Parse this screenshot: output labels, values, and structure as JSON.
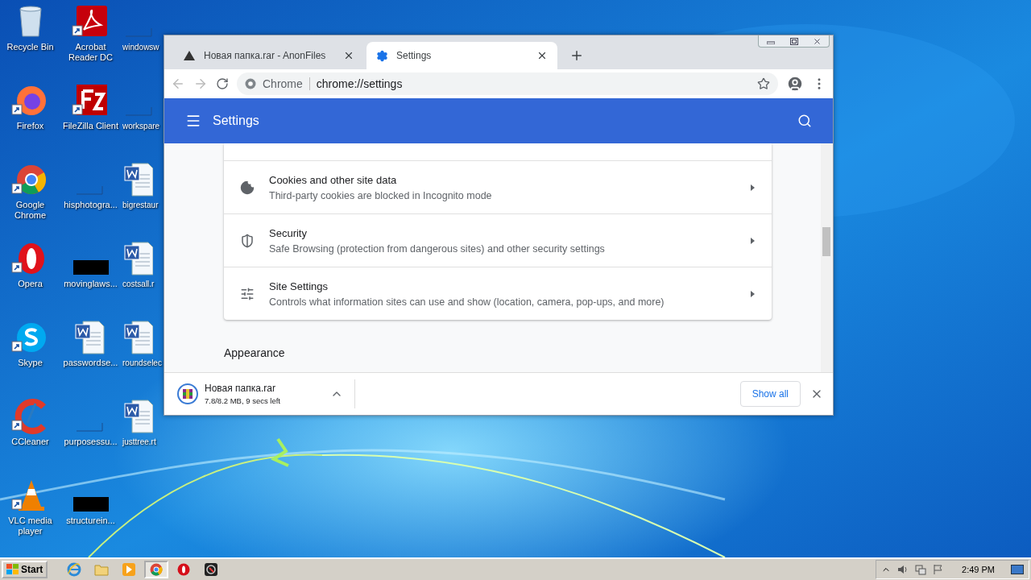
{
  "desktop": {
    "icons": [
      {
        "label": "Recycle Bin",
        "kind": "recycle"
      },
      {
        "label": "Firefox",
        "kind": "firefox"
      },
      {
        "label": "Google Chrome",
        "kind": "chrome"
      },
      {
        "label": "Opera",
        "kind": "opera"
      },
      {
        "label": "Skype",
        "kind": "skype"
      },
      {
        "label": "CCleaner",
        "kind": "ccleaner"
      },
      {
        "label": "VLC media player",
        "kind": "vlc"
      },
      {
        "label": "Acrobat Reader DC",
        "kind": "pdf"
      },
      {
        "label": "FileZilla Client",
        "kind": "filezilla"
      },
      {
        "label": "hisphotogra...",
        "kind": "blank"
      },
      {
        "label": "movinglaws...",
        "kind": "redacted"
      },
      {
        "label": "passwordse...",
        "kind": "word"
      },
      {
        "label": "purposessu...",
        "kind": "blank"
      },
      {
        "label": "structurein...",
        "kind": "redacted"
      },
      {
        "label": "windowsw",
        "kind": "blank"
      },
      {
        "label": "workspare",
        "kind": "blank"
      },
      {
        "label": "bigrestaur",
        "kind": "word"
      },
      {
        "label": "costsall.r",
        "kind": "word"
      },
      {
        "label": "roundselec",
        "kind": "word"
      },
      {
        "label": "justtree.rt",
        "kind": "word"
      }
    ]
  },
  "browser": {
    "tabs": [
      {
        "title": "Новая папка.rar - AnonFiles",
        "selected": false,
        "kind": "site"
      },
      {
        "title": "Settings",
        "selected": true,
        "kind": "settings"
      }
    ],
    "address": {
      "label": "Chrome",
      "url": "chrome://settings"
    },
    "header": {
      "title": "Settings"
    },
    "rows": [
      {
        "title": "Cookies and other site data",
        "description": "Third-party cookies are blocked in Incognito mode",
        "kind": "cookies"
      },
      {
        "title": "Security",
        "description": "Safe Browsing (protection from dangerous sites) and other security settings",
        "kind": "security"
      },
      {
        "title": "Site Settings",
        "description": "Controls what information sites can use and show (location, camera, pop-ups, and more)",
        "kind": "sliders"
      }
    ],
    "section_heading": "Appearance",
    "download": {
      "filename": "Новая папка.rar",
      "status": "7.8/8.2 MB, 9 secs left",
      "show_all": "Show all"
    }
  },
  "taskbar": {
    "start": "Start",
    "items": [
      {
        "kind": "ie",
        "selected": false
      },
      {
        "kind": "folder",
        "selected": false
      },
      {
        "kind": "media",
        "selected": false
      },
      {
        "kind": "chrome",
        "selected": true
      },
      {
        "kind": "opera",
        "selected": false
      },
      {
        "kind": "app",
        "selected": false
      }
    ],
    "clock": "2:49 PM"
  }
}
